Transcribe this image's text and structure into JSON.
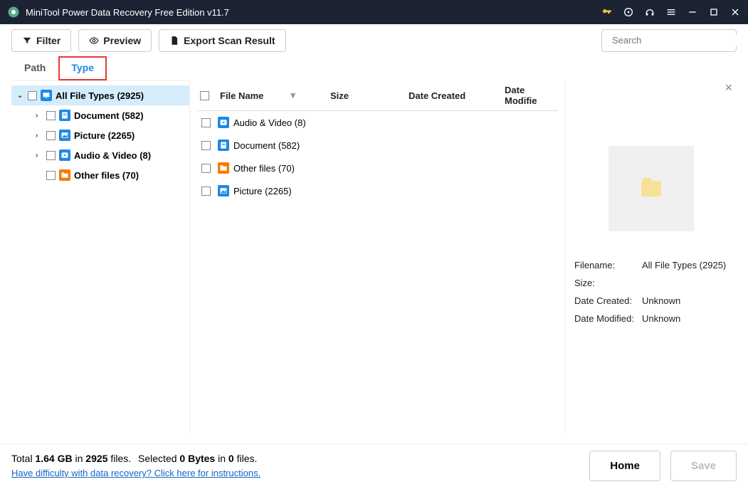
{
  "title": "MiniTool Power Data Recovery Free Edition v11.7",
  "toolbar": {
    "filter": "Filter",
    "preview": "Preview",
    "export": "Export Scan Result",
    "search_placeholder": "Search"
  },
  "tabs": {
    "path": "Path",
    "type": "Type"
  },
  "tree": {
    "root": "All File Types (2925)",
    "items": [
      {
        "label": "Document (582)",
        "icon": "doc"
      },
      {
        "label": "Picture (2265)",
        "icon": "pic"
      },
      {
        "label": "Audio & Video (8)",
        "icon": "av"
      },
      {
        "label": "Other files (70)",
        "icon": "other",
        "noexpand": true
      }
    ]
  },
  "list": {
    "headers": {
      "name": "File Name",
      "size": "Size",
      "created": "Date Created",
      "modified": "Date Modifie"
    },
    "rows": [
      {
        "label": "Audio & Video (8)",
        "icon": "av"
      },
      {
        "label": "Document (582)",
        "icon": "doc"
      },
      {
        "label": "Other files (70)",
        "icon": "other"
      },
      {
        "label": "Picture (2265)",
        "icon": "pic"
      }
    ]
  },
  "details": {
    "filename_lbl": "Filename:",
    "filename_val": "All File Types (2925)",
    "size_lbl": "Size:",
    "size_val": "",
    "created_lbl": "Date Created:",
    "created_val": "Unknown",
    "modified_lbl": "Date Modified:",
    "modified_val": "Unknown"
  },
  "footer": {
    "total_prefix": "Total ",
    "total_size": "1.64 GB",
    "total_mid": " in ",
    "total_count": "2925",
    "total_suffix": " files.",
    "sel_prefix": "Selected ",
    "sel_bytes": "0 Bytes",
    "sel_mid": " in ",
    "sel_count": "0",
    "sel_suffix": " files.",
    "help_link": "Have difficulty with data recovery? Click here for instructions.",
    "home": "Home",
    "save": "Save"
  }
}
